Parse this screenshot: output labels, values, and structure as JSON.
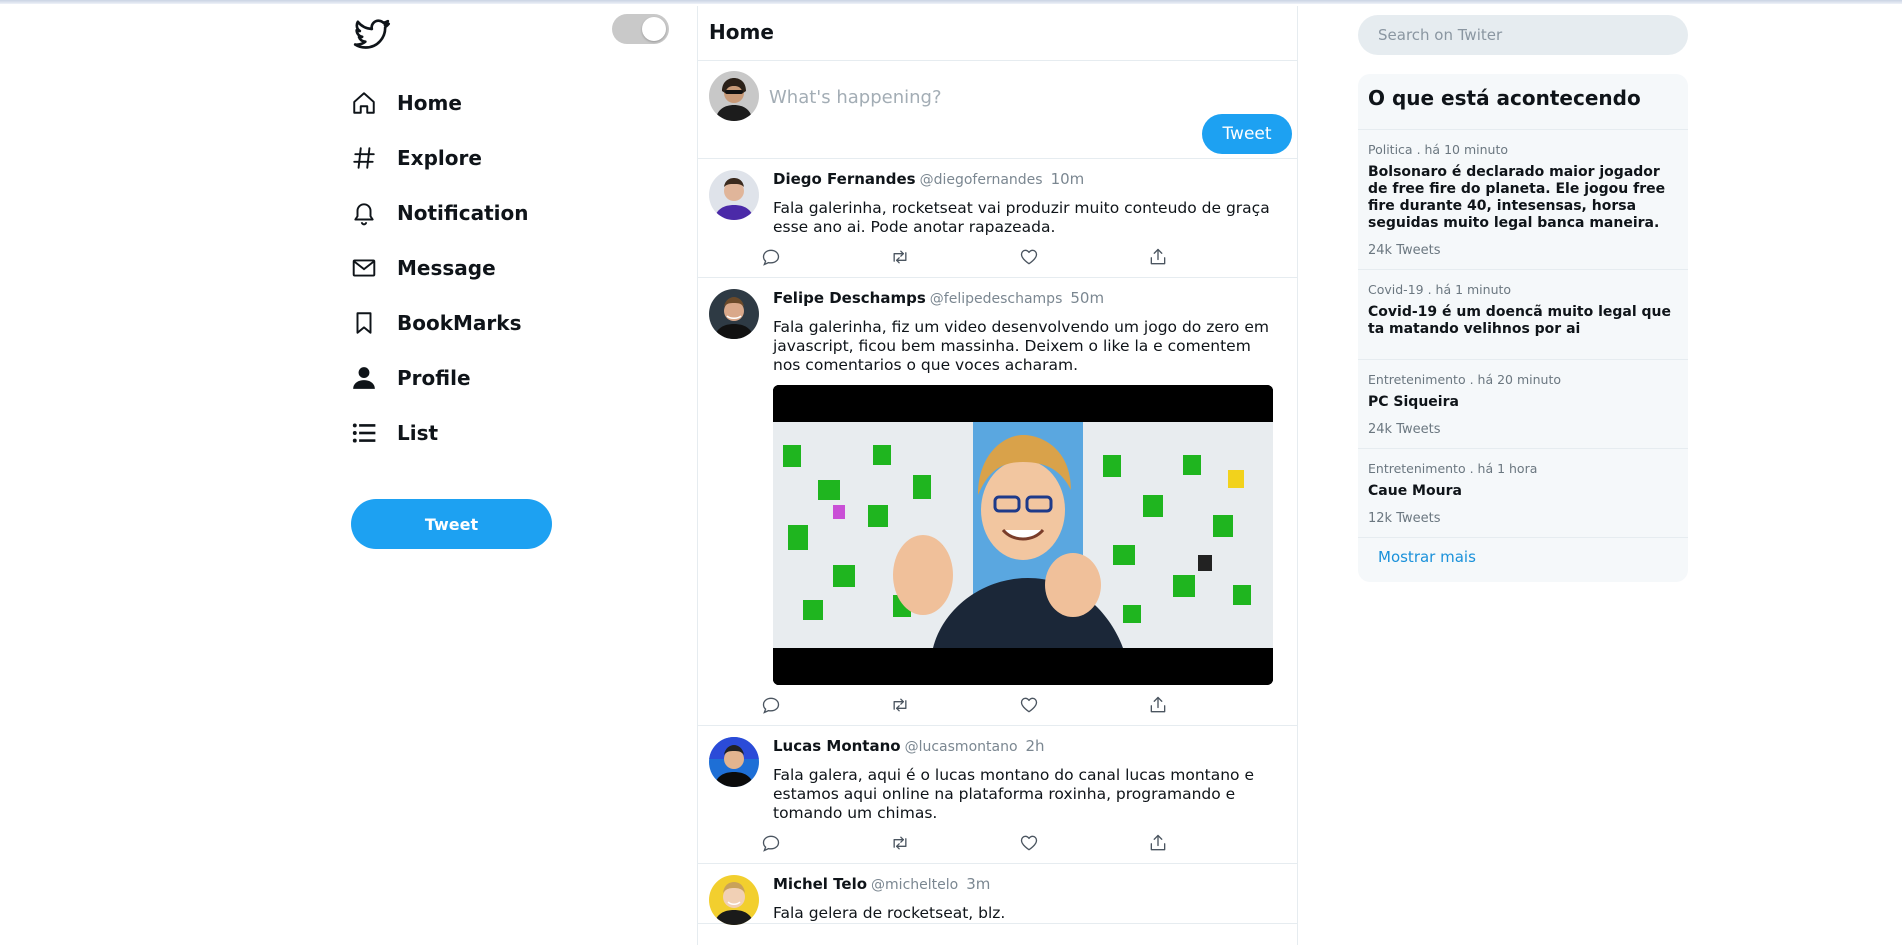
{
  "colors": {
    "accent": "#1da1f2",
    "text": "#0f1419",
    "muted": "#7b8791",
    "border": "#e6ecf0"
  },
  "sidebar": {
    "logo_icon": "twitter-bird-icon",
    "theme_toggle": "dark-mode-toggle",
    "nav": [
      {
        "label": "Home",
        "icon": "home-icon"
      },
      {
        "label": "Explore",
        "icon": "hashtag-icon"
      },
      {
        "label": "Notification",
        "icon": "bell-icon"
      },
      {
        "label": "Message",
        "icon": "mail-icon"
      },
      {
        "label": "BookMarks",
        "icon": "bookmark-icon"
      },
      {
        "label": "Profile",
        "icon": "user-icon"
      },
      {
        "label": "List",
        "icon": "list-icon"
      }
    ],
    "tweet_button": "Tweet"
  },
  "feed": {
    "title": "Home",
    "composer": {
      "placeholder": "What's happening?",
      "button": "Tweet"
    },
    "posts": [
      {
        "name": "Diego Fernandes",
        "handle": "@diegofernandes",
        "time": "10m",
        "text": "Fala galerinha, rocketseat vai produzir muito conteudo de graça esse ano ai. Pode anotar rapazeada."
      },
      {
        "name": "Felipe Deschamps",
        "handle": "@felipedeschamps",
        "time": "50m",
        "text": "Fala galerinha, fiz um video desenvolvendo um jogo do zero em javascript, ficou bem massinha. Deixem o like la e comentem nos comentarios o que voces acharam."
      },
      {
        "name": "Lucas Montano",
        "handle": "@lucasmontano",
        "time": "2h",
        "text": "Fala galera, aqui é o lucas montano do canal lucas montano e estamos aqui online na plataforma roxinha, programando e tomando um chimas."
      },
      {
        "name": "Michel Telo",
        "handle": "@micheltelo",
        "time": "3m",
        "text": "Fala gelera de rocketseat, blz."
      }
    ],
    "action_icons": [
      "reply-icon",
      "retweet-icon",
      "like-icon",
      "share-icon"
    ]
  },
  "right": {
    "search_placeholder": "Search on Twiter",
    "trends_title": "O que está acontecendo",
    "trends": [
      {
        "category": "Politica . há 10 minuto",
        "title": "Bolsonaro é declarado maior jogador de free fire do planeta. Ele jogou free fire durante 40, intesensas, horsa seguidas muito legal banca maneira.",
        "count": "24k Tweets"
      },
      {
        "category": "Covid-19 . há 1 minuto",
        "title": "Covid-19 é um doencã muito legal que ta matando velihnos por ai",
        "count": ""
      },
      {
        "category": "Entretenimento . há 20 minuto",
        "title": "PC Siqueira",
        "count": "24k Tweets"
      },
      {
        "category": "Entretenimento . há 1 hora",
        "title": "Caue Moura",
        "count": "12k Tweets"
      }
    ],
    "show_more": "Mostrar mais"
  }
}
